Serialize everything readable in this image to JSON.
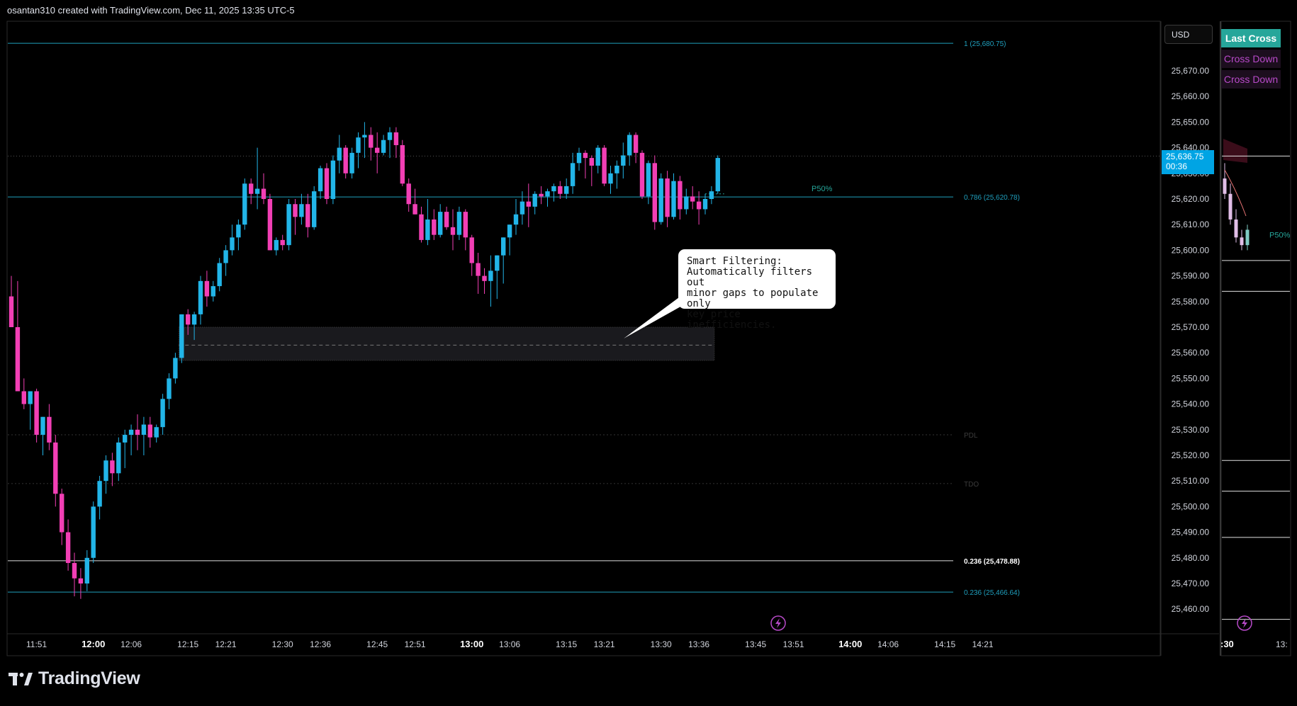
{
  "header": {
    "attribution": "osantan310 created with TradingView.com, Dec 11, 2025 13:35 UTC-5"
  },
  "brand": {
    "name": "TradingView"
  },
  "currency_button": "USD",
  "price_badge": {
    "price": "25,636.75",
    "countdown": "00:36"
  },
  "legend": {
    "last_cross": "Last Cross",
    "cross_down_1": "Cross Down",
    "cross_down_2": "Cross Down"
  },
  "callout": {
    "text": "Smart Filtering:\nAutomatically filters out\nminor gaps to populate only\nkey price inefficiencies."
  },
  "colors": {
    "up": "#22b5e8",
    "down": "#f23fb5",
    "fib_line": "#1f9fbd",
    "bg": "#000000",
    "text": "#d1d4dc"
  },
  "chart_data": {
    "type": "candlestick",
    "ylim": [
      25455,
      25700
    ],
    "y_ticks": [
      25670,
      25660,
      25650,
      25640,
      25630,
      25620,
      25610,
      25600,
      25590,
      25580,
      25570,
      25560,
      25550,
      25540,
      25530,
      25520,
      25510,
      25500,
      25490,
      25480,
      25470,
      25460
    ],
    "y_tick_labels": [
      "25,670.00",
      "25,660.00",
      "25,650.00",
      "25,640.00",
      "25,630.00",
      "25,620.00",
      "25,610.00",
      "25,600.00",
      "25,590.00",
      "25,580.00",
      "25,570.00",
      "25,560.00",
      "25,550.00",
      "25,540.00",
      "25,530.00",
      "25,520.00",
      "25,510.00",
      "25,500.00",
      "25,490.00",
      "25,480.00",
      "25,470.00",
      "25,460.00"
    ],
    "x_tick_labels": [
      {
        "bar": 4,
        "label": "11:51",
        "bold": false
      },
      {
        "bar": 13,
        "label": "12:00",
        "bold": true
      },
      {
        "bar": 19,
        "label": "12:06",
        "bold": false
      },
      {
        "bar": 28,
        "label": "12:15",
        "bold": false
      },
      {
        "bar": 34,
        "label": "12:21",
        "bold": false
      },
      {
        "bar": 43,
        "label": "12:30",
        "bold": false
      },
      {
        "bar": 49,
        "label": "12:36",
        "bold": false
      },
      {
        "bar": 58,
        "label": "12:45",
        "bold": false
      },
      {
        "bar": 64,
        "label": "12:51",
        "bold": false
      },
      {
        "bar": 73,
        "label": "13:00",
        "bold": true
      },
      {
        "bar": 79,
        "label": "13:06",
        "bold": false
      },
      {
        "bar": 88,
        "label": "13:15",
        "bold": false
      },
      {
        "bar": 94,
        "label": "13:21",
        "bold": false
      },
      {
        "bar": 103,
        "label": "13:30",
        "bold": false
      },
      {
        "bar": 109,
        "label": "13:36",
        "bold": false
      },
      {
        "bar": 118,
        "label": "13:45",
        "bold": false
      },
      {
        "bar": 124,
        "label": "13:51",
        "bold": false
      },
      {
        "bar": 133,
        "label": "14:00",
        "bold": true
      },
      {
        "bar": 139,
        "label": "14:06",
        "bold": false
      },
      {
        "bar": 148,
        "label": "14:15",
        "bold": false
      },
      {
        "bar": 154,
        "label": "14:21",
        "bold": false
      }
    ],
    "ohlc": [
      [
        25582,
        25590,
        25570,
        25570
      ],
      [
        25570,
        25588,
        25545,
        25545
      ],
      [
        25545,
        25550,
        25538,
        25540
      ],
      [
        25540,
        25545,
        25530,
        25545
      ],
      [
        25545,
        25546,
        25525,
        25528
      ],
      [
        25528,
        25535,
        25520,
        25535
      ],
      [
        25535,
        25540,
        25522,
        25525
      ],
      [
        25525,
        25528,
        25500,
        25505
      ],
      [
        25505,
        25507,
        25485,
        25490
      ],
      [
        25490,
        25495,
        25475,
        25478
      ],
      [
        25478,
        25482,
        25465,
        25472
      ],
      [
        25472,
        25476,
        25464,
        25470
      ],
      [
        25470,
        25483,
        25467,
        25480
      ],
      [
        25480,
        25502,
        25478,
        25500
      ],
      [
        25500,
        25512,
        25495,
        25510
      ],
      [
        25510,
        25520,
        25505,
        25518
      ],
      [
        25518,
        25521,
        25508,
        25513
      ],
      [
        25513,
        25527,
        25510,
        25525
      ],
      [
        25525,
        25530,
        25515,
        25528
      ],
      [
        25528,
        25532,
        25520,
        25530
      ],
      [
        25530,
        25536,
        25522,
        25528
      ],
      [
        25528,
        25535,
        25520,
        25532
      ],
      [
        25532,
        25535,
        25523,
        25527
      ],
      [
        25527,
        25532,
        25525,
        25531
      ],
      [
        25531,
        25544,
        25528,
        25542
      ],
      [
        25542,
        25552,
        25538,
        25550
      ],
      [
        25550,
        25560,
        25548,
        25558
      ],
      [
        25558,
        25575,
        25556,
        25575
      ],
      [
        25575,
        25577,
        25567,
        25571
      ],
      [
        25571,
        25576,
        25565,
        25575
      ],
      [
        25575,
        25590,
        25571,
        25588
      ],
      [
        25588,
        25592,
        25578,
        25582
      ],
      [
        25582,
        25588,
        25580,
        25586
      ],
      [
        25586,
        25597,
        25584,
        25595
      ],
      [
        25595,
        25602,
        25590,
        25600
      ],
      [
        25600,
        25610,
        25598,
        25605
      ],
      [
        25605,
        25612,
        25600,
        25610
      ],
      [
        25610,
        25628,
        25608,
        25626
      ],
      [
        25626,
        25628,
        25618,
        25622
      ],
      [
        25622,
        25640,
        25616,
        25624
      ],
      [
        25624,
        25630,
        25618,
        25620
      ],
      [
        25620,
        25622,
        25600,
        25600
      ],
      [
        25600,
        25605,
        25598,
        25604
      ],
      [
        25604,
        25606,
        25600,
        25602
      ],
      [
        25602,
        25620,
        25600,
        25618
      ],
      [
        25618,
        25620,
        25606,
        25613
      ],
      [
        25613,
        25622,
        25610,
        25618
      ],
      [
        25618,
        25622,
        25605,
        25609
      ],
      [
        25609,
        25625,
        25608,
        25623
      ],
      [
        25623,
        25633,
        25620,
        25632
      ],
      [
        25632,
        25634,
        25618,
        25620
      ],
      [
        25620,
        25637,
        25618,
        25635
      ],
      [
        25635,
        25645,
        25630,
        25640
      ],
      [
        25640,
        25641,
        25628,
        25630
      ],
      [
        25630,
        25640,
        25628,
        25638
      ],
      [
        25638,
        25646,
        25632,
        25644
      ],
      [
        25644,
        25650,
        25636,
        25645
      ],
      [
        25645,
        25648,
        25635,
        25640
      ],
      [
        25640,
        25646,
        25630,
        25638
      ],
      [
        25638,
        25645,
        25637,
        25643
      ],
      [
        25643,
        25648,
        25636,
        25646
      ],
      [
        25646,
        25648,
        25636,
        25641
      ],
      [
        25641,
        25643,
        25625,
        25626
      ],
      [
        25626,
        25628,
        25615,
        25618
      ],
      [
        25618,
        25624,
        25614,
        25614
      ],
      [
        25614,
        25617,
        25603,
        25604
      ],
      [
        25604,
        25620,
        25602,
        25612
      ],
      [
        25612,
        25616,
        25604,
        25606
      ],
      [
        25606,
        25618,
        25605,
        25615
      ],
      [
        25615,
        25617,
        25608,
        25609
      ],
      [
        25609,
        25616,
        25600,
        25606
      ],
      [
        25606,
        25617,
        25604,
        25615
      ],
      [
        25615,
        25616,
        25600,
        25605
      ],
      [
        25605,
        25606,
        25590,
        25595
      ],
      [
        25595,
        25599,
        25583,
        25590
      ],
      [
        25590,
        25593,
        25583,
        25588
      ],
      [
        25588,
        25598,
        25578,
        25592
      ],
      [
        25592,
        25598,
        25581,
        25598
      ],
      [
        25598,
        25605,
        25587,
        25605
      ],
      [
        25605,
        25610,
        25598,
        25610
      ],
      [
        25610,
        25620,
        25606,
        25614
      ],
      [
        25614,
        25623,
        25610,
        25619
      ],
      [
        25619,
        25626,
        25609,
        25617
      ],
      [
        25617,
        25623,
        25614,
        25622
      ],
      [
        25622,
        25625,
        25618,
        25621
      ],
      [
        25621,
        25624,
        25617,
        25623
      ],
      [
        25623,
        25626,
        25619,
        25625
      ],
      [
        25625,
        25627,
        25620,
        25622
      ],
      [
        25622,
        25628,
        25620,
        25625
      ],
      [
        25625,
        25638,
        25622,
        25634
      ],
      [
        25634,
        25640,
        25631,
        25638
      ],
      [
        25638,
        25639,
        25628,
        25636
      ],
      [
        25636,
        25637,
        25625,
        25633
      ],
      [
        25633,
        25641,
        25630,
        25640
      ],
      [
        25640,
        25641,
        25625,
        25626
      ],
      [
        25626,
        25633,
        25622,
        25630
      ],
      [
        25630,
        25635,
        25624,
        25633
      ],
      [
        25633,
        25642,
        25628,
        25637
      ],
      [
        25637,
        25646,
        25633,
        25645
      ],
      [
        25645,
        25646,
        25634,
        25638
      ],
      [
        25638,
        25639,
        25620,
        25621
      ],
      [
        25621,
        25635,
        25618,
        25634
      ],
      [
        25634,
        25637,
        25608,
        25611
      ],
      [
        25611,
        25630,
        25610,
        25628
      ],
      [
        25628,
        25631,
        25609,
        25613
      ],
      [
        25613,
        25630,
        25612,
        25627
      ],
      [
        25627,
        25629,
        25612,
        25616
      ],
      [
        25616,
        25624,
        25614,
        25621
      ],
      [
        25621,
        25625,
        25616,
        25619
      ],
      [
        25619,
        25623,
        25610,
        25616
      ],
      [
        25616,
        25622,
        25614,
        25620
      ],
      [
        25620,
        25625,
        25618,
        25623
      ],
      [
        25623,
        25637,
        25622,
        25636
      ]
    ],
    "levels": [
      {
        "name": "1 (25,680.75)",
        "price": 25680.75
      },
      {
        "name": "0.786 (25,620.78)",
        "price": 25620.78
      },
      {
        "name": "PDL",
        "price": 25528
      },
      {
        "name": "TDO",
        "price": 25509
      },
      {
        "name": "0.236 (25,478.88)",
        "price": 25478.88
      },
      {
        "name": "0.236 (25,466.64)",
        "price": 25466.64
      }
    ],
    "gap_zone": {
      "top": 25570,
      "bottom": 25557,
      "mid": 25563,
      "from_bar": 27,
      "to_bar": 111
    },
    "p50_label": "P50%",
    "p50_price": 25622,
    "current_price": 25636.75
  },
  "inset": {
    "time_label": ":30",
    "time_label_2": "13:",
    "p50_label": "P50%",
    "level_y_prices": [
      25636.75,
      25596,
      25584,
      25518,
      25506,
      25488,
      25456
    ]
  }
}
